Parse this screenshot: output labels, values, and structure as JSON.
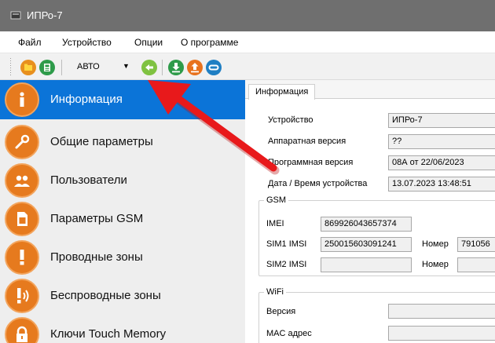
{
  "window": {
    "title": "ИПРо-7"
  },
  "menu": {
    "items": [
      "Файл",
      "Устройство",
      "Опции",
      "О программе"
    ]
  },
  "toolbar": {
    "mode_value": "АВТО",
    "colors": {
      "open": "#e8901e",
      "save": "#2e9b4a",
      "refresh": "#7fc241",
      "download": "#2e9b4a",
      "upload": "#e8721e",
      "connect": "#1f7fc3"
    }
  },
  "sidebar": {
    "items": [
      {
        "label": "Информация",
        "icon": "info-icon",
        "active": true
      },
      {
        "label": "Общие параметры",
        "icon": "wrench-icon"
      },
      {
        "label": "Пользователи",
        "icon": "users-icon"
      },
      {
        "label": "Параметры GSM",
        "icon": "sim-card-icon"
      },
      {
        "label": "Проводные зоны",
        "icon": "exclamation-icon"
      },
      {
        "label": "Беспроводные зоны",
        "icon": "wireless-exclamation-icon"
      },
      {
        "label": "Ключи Touch Memory",
        "icon": "lock-icon"
      }
    ]
  },
  "tab": {
    "label": "Информация"
  },
  "info": {
    "device_label": "Устройство",
    "device_value": "ИПРо-7",
    "hw_label": "Аппаратная версия",
    "hw_value": "??",
    "fw_label": "Программная версия",
    "fw_value": "08А от 22/06/2023",
    "datetime_label": "Дата / Время устройства",
    "datetime_value": "13.07.2023 13:48:51"
  },
  "gsm": {
    "title": "GSM",
    "imei_label": "IMEI",
    "imei_value": "869926043657374",
    "sim1_label": "SIM1 IMSI",
    "sim1_value": "250015603091241",
    "sim1_number_label": "Номер",
    "sim1_number_value": "791056",
    "sim2_label": "SIM2 IMSI",
    "sim2_value": "",
    "sim2_number_label": "Номер",
    "sim2_number_value": ""
  },
  "wifi": {
    "title": "WiFi",
    "version_label": "Версия",
    "version_value": "",
    "mac_label": "MAC адрес",
    "mac_value": ""
  },
  "annotation": {
    "arrow_color": "#e8191b"
  }
}
